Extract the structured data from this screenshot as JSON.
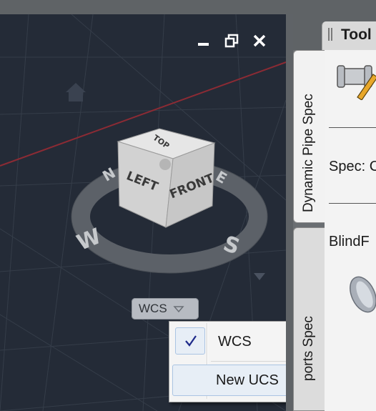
{
  "viewport": {
    "compass": {
      "north": "N",
      "south": "S",
      "east": "E",
      "west": "W"
    },
    "viewcube_faces": {
      "top": "TOP",
      "left": "LEFT",
      "front": "FRONT"
    },
    "coordinate_system_selector": {
      "current": "WCS"
    }
  },
  "ucs_menu": {
    "items": [
      {
        "label": "WCS",
        "checked": true
      },
      {
        "label": "New UCS",
        "checked": false
      }
    ]
  },
  "tool_palette": {
    "title": "Tool",
    "tabs": [
      {
        "label": "Dynamic Pipe Spec",
        "active": true
      },
      {
        "label": "ports Spec",
        "active": false
      }
    ],
    "content": {
      "spec_label": "Spec: C",
      "item_label": "BlindF"
    }
  },
  "colors": {
    "viewport_background": "#242b37",
    "x_axis_line": "#8b2b34",
    "menu_highlight": "#e7eef6",
    "check_mark": "#1e2a8a"
  },
  "icons": [
    "minimize-icon",
    "restore-icon",
    "close-icon",
    "home-icon",
    "chevron-down-icon",
    "check-icon",
    "grip-icon",
    "pipe-tool-icon",
    "blind-flange-icon"
  ]
}
